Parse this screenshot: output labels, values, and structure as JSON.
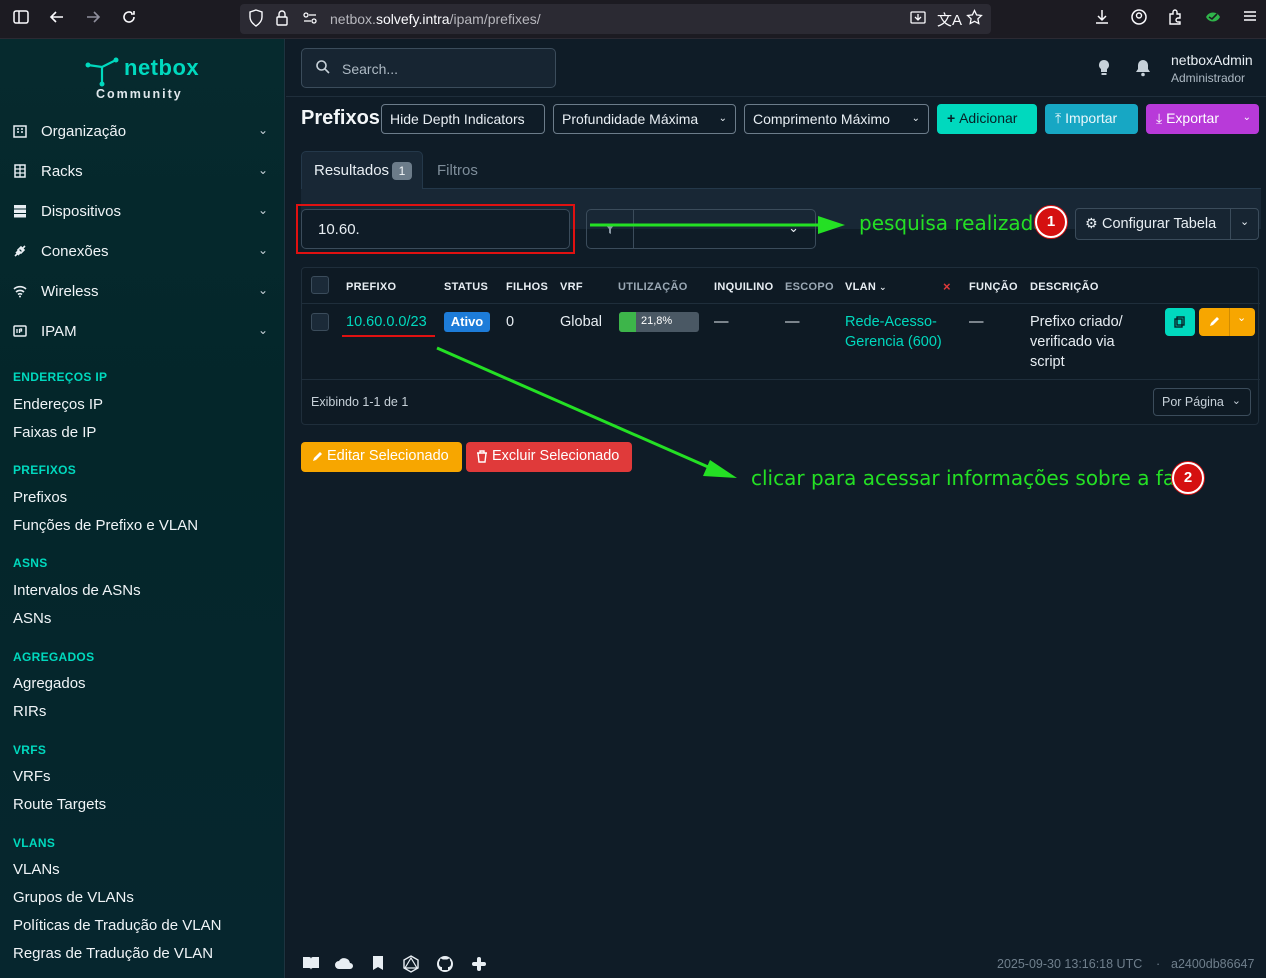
{
  "browser": {
    "url_prefix": "netbox.",
    "url_host": "solvefy.intra",
    "url_path": "/ipam/prefixes/"
  },
  "logo": {
    "word": "netbox",
    "sub": "Community"
  },
  "sidebar": {
    "menu": [
      {
        "label": "Organização",
        "icon": "building-icon"
      },
      {
        "label": "Racks",
        "icon": "rack-icon"
      },
      {
        "label": "Dispositivos",
        "icon": "server-icon"
      },
      {
        "label": "Conexões",
        "icon": "plug-icon"
      },
      {
        "label": "Wireless",
        "icon": "wifi-icon"
      },
      {
        "label": "IPAM",
        "icon": "ip-icon"
      }
    ],
    "sections": [
      {
        "title": "ENDEREÇOS IP",
        "items": [
          "Endereços IP",
          "Faixas de IP"
        ]
      },
      {
        "title": "PREFIXOS",
        "items": [
          "Prefixos",
          "Funções de Prefixo e VLAN"
        ]
      },
      {
        "title": "ASNS",
        "items": [
          "Intervalos de ASNs",
          "ASNs"
        ]
      },
      {
        "title": "AGREGADOS",
        "items": [
          "Agregados",
          "RIRs"
        ]
      },
      {
        "title": "VRFS",
        "items": [
          "VRFs",
          "Route Targets"
        ]
      },
      {
        "title": "VLANS",
        "items": [
          "VLANs",
          "Grupos de VLANs",
          "Políticas de Tradução de VLAN",
          "Regras de Tradução de VLAN"
        ]
      }
    ]
  },
  "header": {
    "search_placeholder": "Search...",
    "user_name": "netboxAdmin",
    "user_role": "Administrador"
  },
  "page": {
    "title": "Prefixos",
    "buttons": {
      "hide_depth": "Hide Depth Indicators",
      "max_depth": "Profundidade Máxima",
      "max_length": "Comprimento Máximo",
      "add": "Adicionar",
      "import": "Importar",
      "export": "Exportar"
    },
    "tabs": {
      "results": "Resultados",
      "results_count": "1",
      "filters": "Filtros"
    },
    "quick_search_value": "10.60.",
    "configure_table": "Configurar Tabela"
  },
  "table": {
    "headers": [
      "PREFIXO",
      "STATUS",
      "FILHOS",
      "VRF",
      "UTILIZAÇÃO",
      "INQUILINO",
      "ESCOPO",
      "VLAN",
      "FUNÇÃO",
      "DESCRIÇÃO"
    ],
    "clear_sort": "×",
    "row": {
      "prefix": "10.60.0.0/23",
      "status": "Ativo",
      "children": "0",
      "vrf": "Global",
      "utilization_label": "21,8%",
      "utilization": 0.218,
      "tenant": "—",
      "scope": "—",
      "vlan_line1": "Rede-Acesso-",
      "vlan_line2": "Gerencia (600)",
      "role": "—",
      "desc_line1": "Prefixo criado/",
      "desc_line2": "verificado via",
      "desc_line3": "script"
    },
    "footer": "Exibindo 1-1 de 1",
    "per_page": "Por Página"
  },
  "bulk": {
    "edit": "Editar Selecionado",
    "delete": "Excluir Selecionado"
  },
  "annotations": {
    "a1": "pesquisa realizada",
    "n1": "1",
    "a2": "clicar para acessar informações sobre a faixa",
    "n2": "2"
  },
  "footer": {
    "timestamp": "2025-09-30 13:16:18 UTC",
    "separator": "·",
    "commit": "a2400db86647"
  },
  "colors": {
    "accent": "#00d9be",
    "annotation": "#24e024",
    "highlight": "#e01111"
  }
}
